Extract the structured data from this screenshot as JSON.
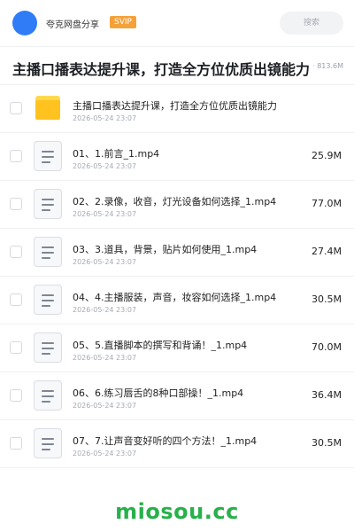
{
  "header": {
    "app_name": "夸克网盘分享",
    "badge": "SVIP",
    "search_placeholder": "搜索",
    "avatar_color": "#2f7cf6"
  },
  "share": {
    "title": "主播口播表达提升课，打造全方位优质出镜能力",
    "meta": "28 项 · 813.6M"
  },
  "files": [
    {
      "type": "folder",
      "icon": "folder-icon",
      "name": "主播口播表达提升课，打造全方位优质出镜能力",
      "date": "2026-05-24 23:07",
      "size": ""
    },
    {
      "type": "file",
      "icon": "document-icon",
      "name": "01、1.前言_1.mp4",
      "date": "2026-05-24 23:07",
      "size": "25.9M"
    },
    {
      "type": "file",
      "icon": "document-icon",
      "name": "02、2.录像，收音，灯光设备如何选择_1.mp4",
      "date": "2026-05-24 23:07",
      "size": "77.0M"
    },
    {
      "type": "file",
      "icon": "document-icon",
      "name": "03、3.道具，背景，贴片如何使用_1.mp4",
      "date": "2026-05-24 23:07",
      "size": "27.4M"
    },
    {
      "type": "file",
      "icon": "document-icon",
      "name": "04、4.主播服装，声音，妆容如何选择_1.mp4",
      "date": "2026-05-24 23:07",
      "size": "30.5M"
    },
    {
      "type": "file",
      "icon": "document-icon",
      "name": "05、5.直播脚本的撰写和背诵！_1.mp4",
      "date": "2026-05-24 23:07",
      "size": "70.0M"
    },
    {
      "type": "file",
      "icon": "document-icon",
      "name": "06、6.练习唇舌的8种口部操！_1.mp4",
      "date": "2026-05-24 23:07",
      "size": "36.4M"
    },
    {
      "type": "file",
      "icon": "document-icon",
      "name": "07、7.让声音变好听的四个方法！_1.mp4",
      "date": "2026-05-24 23:07",
      "size": "30.5M"
    }
  ],
  "watermark": "miosou.cc",
  "colors": {
    "svip": "#f5a13a",
    "folder": "#ffc21f",
    "watermark": "#27b14a"
  }
}
